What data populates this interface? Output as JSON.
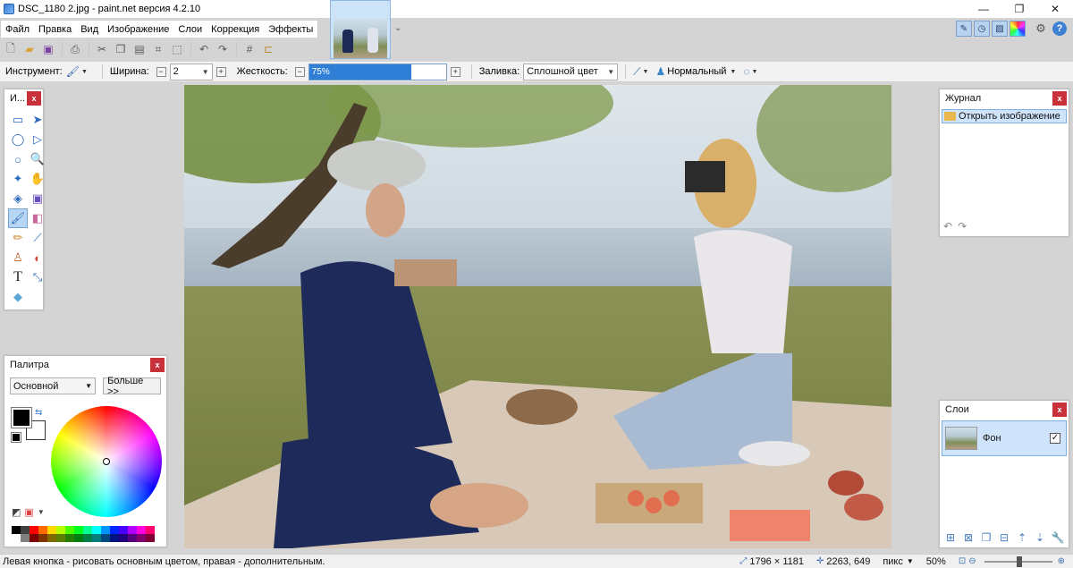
{
  "window": {
    "title": "DSC_1180 2.jpg - paint.net версия 4.2.10",
    "minimize": "—",
    "maximize": "❐",
    "close": "✕"
  },
  "menu": [
    "Файл",
    "Правка",
    "Вид",
    "Изображение",
    "Слои",
    "Коррекция",
    "Эффекты"
  ],
  "toolbar": {
    "icons": [
      "new-icon",
      "open-icon",
      "save-icon",
      "print-icon",
      "cut-icon",
      "copy-icon",
      "paste-icon",
      "crop-icon",
      "deselect-icon",
      "undo-icon",
      "redo-icon",
      "grid-icon",
      "ruler-icon"
    ]
  },
  "options": {
    "tool_label": "Инструмент:",
    "width_label": "Ширина:",
    "width_value": "2",
    "hardness_label": "Жесткость:",
    "hardness_value": "75%",
    "hardness_level": 0.75,
    "fill_label": "Заливка:",
    "fill_value": "Сплошной цвет",
    "blend_value": "Нормальный"
  },
  "tools_panel": {
    "title": "И...",
    "tools": [
      "rect-select-icon",
      "move-selection-icon",
      "lasso-icon",
      "move-selected-icon",
      "ellipse-select-icon",
      "zoom-icon",
      "magic-wand-icon",
      "pan-icon",
      "paint-bucket-icon",
      "gradient-icon",
      "paintbrush-icon",
      "eraser-icon",
      "pencil-icon",
      "color-picker-icon",
      "clone-stamp-icon",
      "recolor-icon",
      "text-icon",
      "line-curve-icon",
      "shapes-icon"
    ]
  },
  "history_panel": {
    "title": "Журнал",
    "items": [
      "Открыть изображение"
    ]
  },
  "layers_panel": {
    "title": "Слои",
    "layers": [
      {
        "name": "Фон",
        "visible": true
      }
    ]
  },
  "palette_panel": {
    "title": "Палитра",
    "mode": "Основной",
    "more_button": "Больше >>",
    "primary_color": "#000000",
    "secondary_color": "#ffffff",
    "strip_row1": [
      "#000000",
      "#404040",
      "#ff0000",
      "#ff6a00",
      "#ffd800",
      "#b6ff00",
      "#4cff00",
      "#00ff21",
      "#00ff90",
      "#00ffff",
      "#0094ff",
      "#0026ff",
      "#4800ff",
      "#b200ff",
      "#ff00dc",
      "#ff006e"
    ],
    "strip_row2": [
      "#ffffff",
      "#808080",
      "#7f0000",
      "#7f3300",
      "#7f6a00",
      "#5b7f00",
      "#267f00",
      "#007f0e",
      "#007f46",
      "#007f7f",
      "#004a7f",
      "#00137f",
      "#21007f",
      "#57007f",
      "#7f006e",
      "#7f0037"
    ]
  },
  "status": {
    "hint": "Левая кнопка - рисовать основным цветом, правая - дополнительным.",
    "image_size": "1796 × 1181",
    "cursor_pos": "2263, 649",
    "units": "пикс",
    "zoom": "50%"
  }
}
